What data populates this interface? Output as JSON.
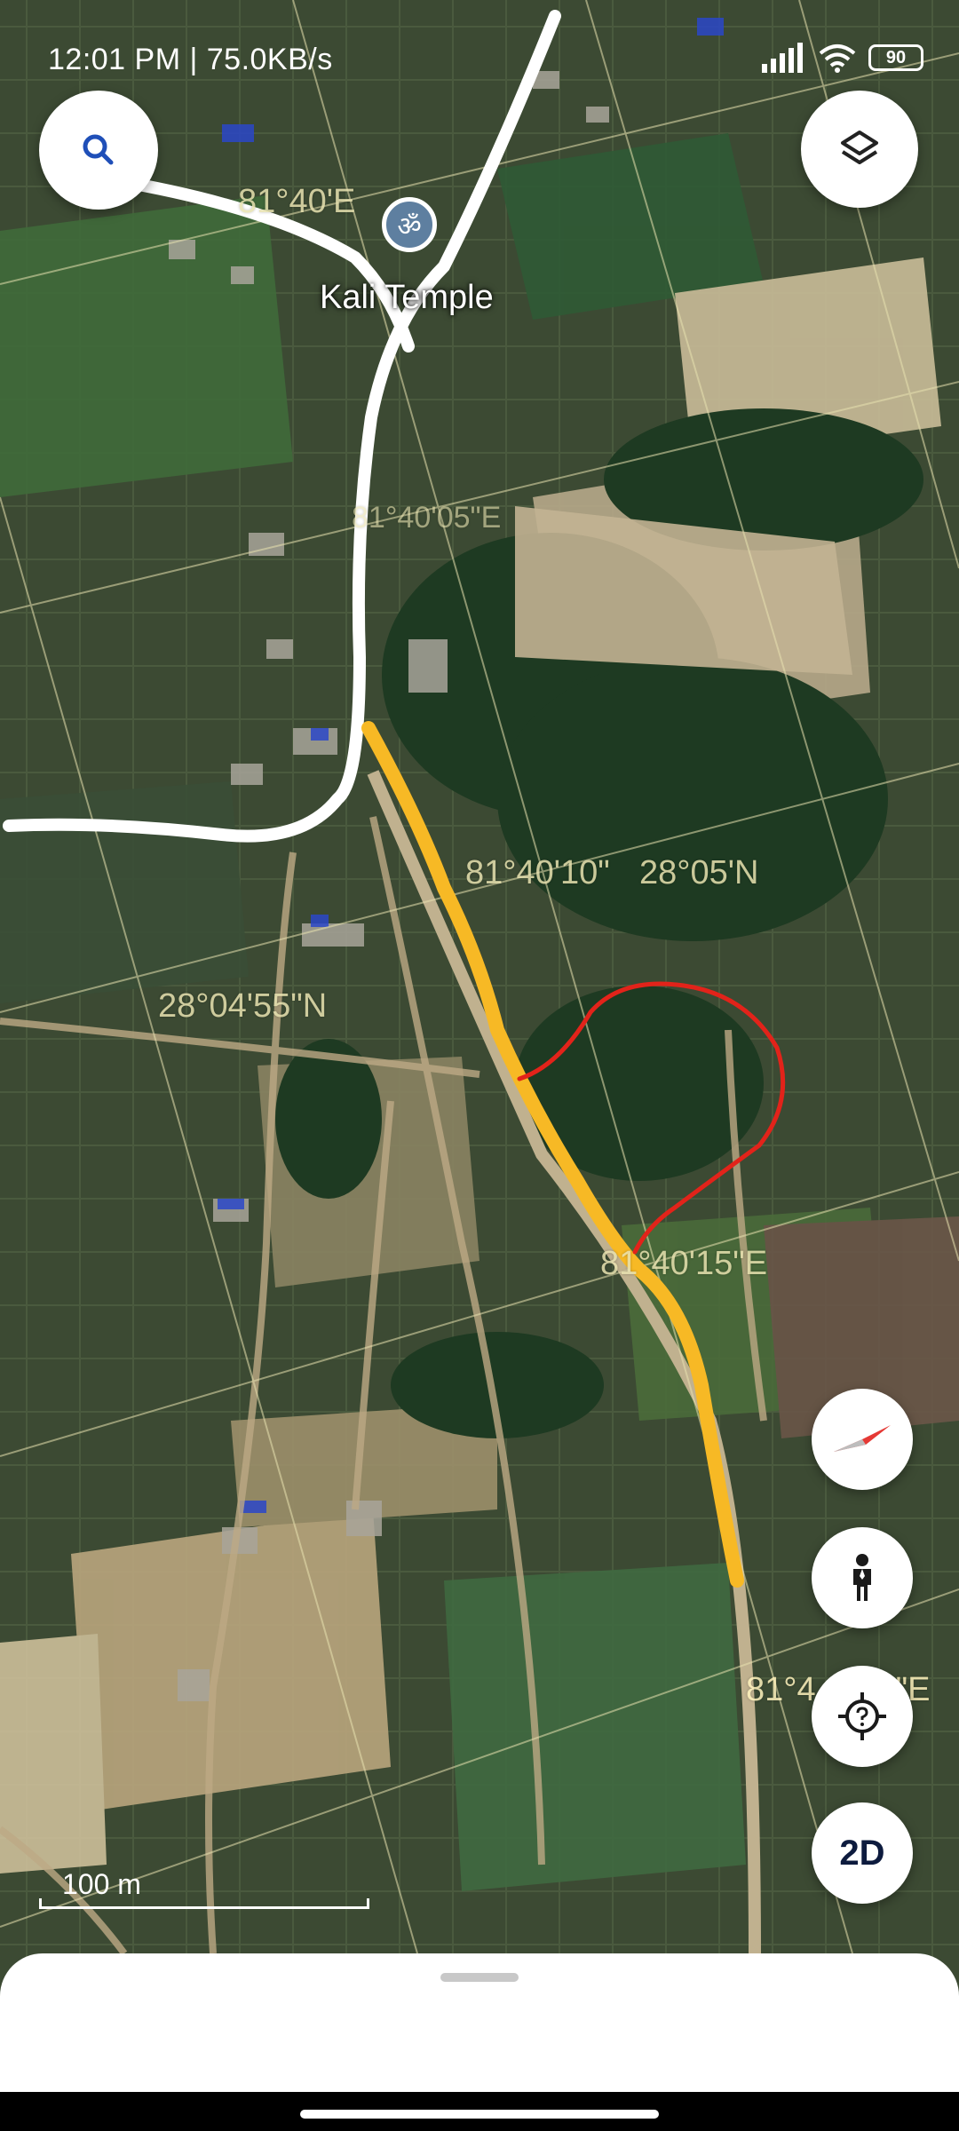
{
  "status_bar": {
    "time_speed": "12:01 PM | 75.0KB/s",
    "battery": "90"
  },
  "map": {
    "poi": {
      "name": "Kali Temple",
      "icon": "om-icon",
      "glyph": "ॐ"
    },
    "grid_labels": {
      "lon_1": "81°40'E",
      "lon_2": "81°40'05\"E",
      "lon_3": "81°40'10\"",
      "lat_1": "28°05'N",
      "lat_2": "28°04'55\"N",
      "lon_4": "81°40'15\"E",
      "lon_5": "81°4",
      "lon_5_suffix": "\"E"
    },
    "scale_label": "100 m",
    "colors": {
      "road_overlay": "#ffffff",
      "path_yellow": "#f7b925",
      "path_red": "#e2231a"
    }
  },
  "controls": {
    "search_icon": "search-icon",
    "layers_icon": "layers-icon",
    "compass_icon": "compass-icon",
    "street_view_icon": "person-icon",
    "locate_icon": "gps-locate-icon",
    "view_mode_label": "2D"
  }
}
